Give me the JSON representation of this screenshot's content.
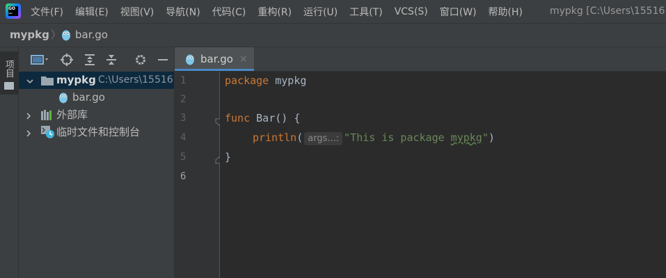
{
  "menubar": {
    "items": [
      "文件(F)",
      "编辑(E)",
      "视图(V)",
      "导航(N)",
      "代码(C)",
      "重构(R)",
      "运行(U)",
      "工具(T)",
      "VCS(S)",
      "窗口(W)",
      "帮助(H)"
    ],
    "window_title": "mypkg [C:\\Users\\15516"
  },
  "navbar": {
    "project": "mypkg",
    "file": "bar.go"
  },
  "side_strip": {
    "project_tab_label": "项目"
  },
  "project_tree": {
    "root": {
      "name": "mypkg",
      "path": "C:\\Users\\15516"
    },
    "children": [
      {
        "name": "bar.go"
      }
    ],
    "external_libraries": "外部库",
    "scratches": "临时文件和控制台"
  },
  "editor": {
    "tab_label": "bar.go",
    "tab_close": "×",
    "line_numbers": [
      "1",
      "2",
      "3",
      "4",
      "5",
      "6"
    ],
    "code": {
      "l1_kw": "package",
      "l1_name": "mypkg",
      "l3_kw": "func",
      "l3_name": "Bar",
      "l3_rest": "() {",
      "l4_call": "println",
      "l4_open": "(",
      "l4_hint": "args...:",
      "l4_str_pre": "\"This is package ",
      "l4_str_typo": "mypkg",
      "l4_str_post": "\"",
      "l4_close": ")",
      "l5": "}"
    },
    "current_line": 6
  },
  "colors": {
    "keyword": "#cc7832",
    "string": "#6a8759",
    "selection": "#0d293e",
    "tab_underline": "#4a88c7"
  }
}
